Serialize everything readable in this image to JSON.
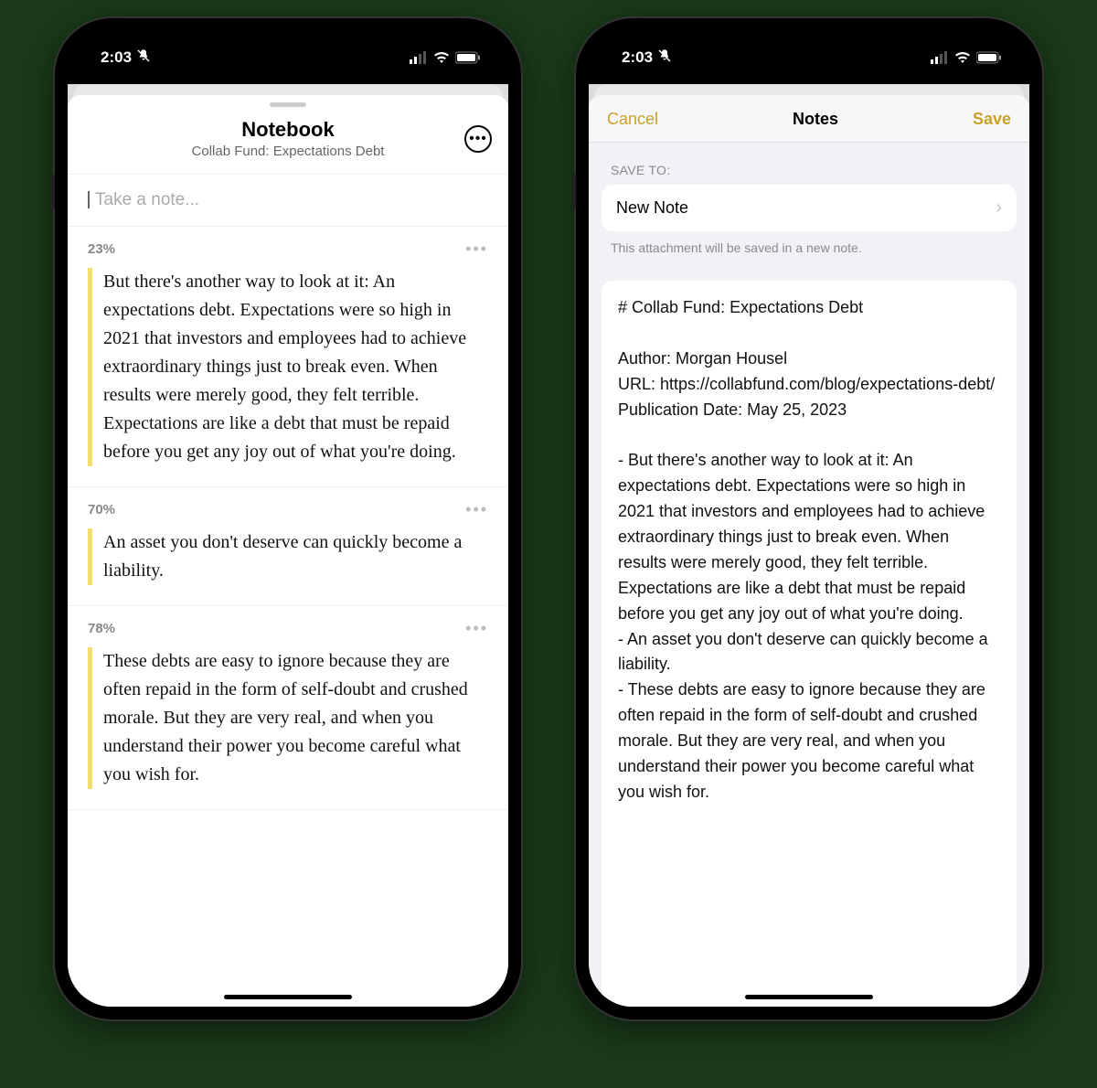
{
  "status": {
    "time": "2:03",
    "silent_icon": "bell-slash"
  },
  "notebook": {
    "title": "Notebook",
    "subtitle": "Collab Fund: Expectations Debt",
    "input_placeholder": "Take a note...",
    "highlights": [
      {
        "percent": "23%",
        "text": "But there's another way to look at it: An expectations debt. Expectations were so high in 2021 that investors and employees had to achieve extraordinary things just to break even. When results were merely good, they felt terrible. Expectations are like a debt that must be repaid before you get any joy out of what you're doing."
      },
      {
        "percent": "70%",
        "text": "An asset you don't deserve can quickly become a liability."
      },
      {
        "percent": "78%",
        "text": "These debts are easy to ignore because they are often repaid in the form of self-doubt and crushed morale. But they are very real, and when you understand their power you become careful what you wish for."
      }
    ]
  },
  "notes": {
    "cancel_label": "Cancel",
    "title": "Notes",
    "save_label": "Save",
    "section_label": "SAVE TO:",
    "row_label": "New Note",
    "hint": "This attachment will be saved in a new note.",
    "content": "# Collab Fund: Expectations Debt\n\nAuthor: Morgan Housel\nURL: https://collabfund.com/blog/expectations-debt/\nPublication Date: May 25, 2023\n\n- But there's another way to look at it: An expectations debt. Expectations were so high in 2021 that investors and employees had to achieve extraordinary things just to break even. When results were merely good, they felt terrible. Expectations are like a debt that must be repaid before you get any joy out of what you're doing.\n- An asset you don't deserve can quickly become a liability.\n- These debts are easy to ignore because they are often repaid in the form of self-doubt and crushed morale. But they are very real, and when you understand their power you become careful what you wish for."
  }
}
